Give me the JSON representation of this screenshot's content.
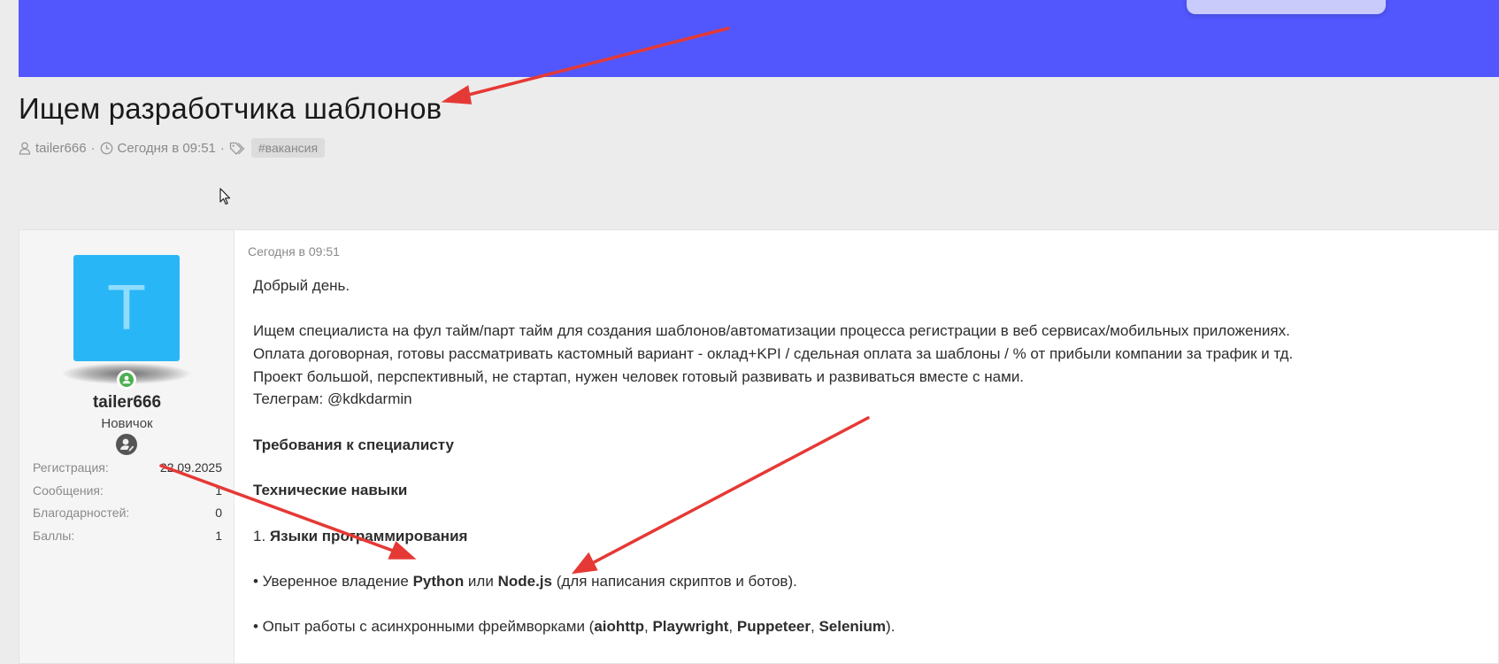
{
  "thread": {
    "title": "Ищем разработчика шаблонов",
    "author": "tailer666",
    "date": "Сегодня в 09:51",
    "tag": "#вакансия"
  },
  "user": {
    "avatar_letter": "T",
    "name": "tailer666",
    "title": "Новичок",
    "stats": [
      {
        "label": "Регистрация:",
        "value": "22.09.2025"
      },
      {
        "label": "Сообщения:",
        "value": "1"
      },
      {
        "label": "Благодарностей:",
        "value": "0"
      },
      {
        "label": "Баллы:",
        "value": "1"
      }
    ]
  },
  "post": {
    "date": "Сегодня в 09:51",
    "greeting": "Добрый день.",
    "p1": "Ищем специалиста на фул тайм/парт тайм для создания шаблонов/автоматизации процесса регистрации в веб сервисах/мобильных приложениях.",
    "p2": "Оплата договорная, готовы рассматривать кастомный вариант - оклад+KPI / сдельная оплата за шаблоны / % от прибыли компании за трафик и тд.",
    "p3": "Проект большой, перспективный, не стартап, нужен человек готовый развивать и развиваться вместе с нами.",
    "p4": "Телеграм: @kdkdarmin",
    "h_requirements": "Требования к специалисту",
    "h_skills": "Технические навыки",
    "list1_num": "1.",
    "list1_title": "Языки программирования",
    "b1_prefix": "• Уверенное владение ",
    "b1_python": "Python",
    "b1_or": " или ",
    "b1_node": "Node.js",
    "b1_suffix": " (для написания скриптов и ботов).",
    "b2_prefix": "• Опыт работы с асинхронными фреймворками (",
    "b2_aiohttp": "aiohttp",
    "b2_sep1": ", ",
    "b2_playwright": "Playwright",
    "b2_sep2": ", ",
    "b2_puppeteer": "Puppeteer",
    "b2_sep3": ", ",
    "b2_selenium": "Selenium",
    "b2_suffix": ")."
  },
  "colors": {
    "banner": "#5257fd",
    "avatar": "#29b6f6",
    "online": "#4caf50",
    "annotation_arrow": "#e53935"
  },
  "icons": {
    "author": "user-icon",
    "date": "clock-icon",
    "tags": "tag-icon",
    "cursor": "mouse-cursor-icon",
    "badge": "user-badge-icon"
  }
}
